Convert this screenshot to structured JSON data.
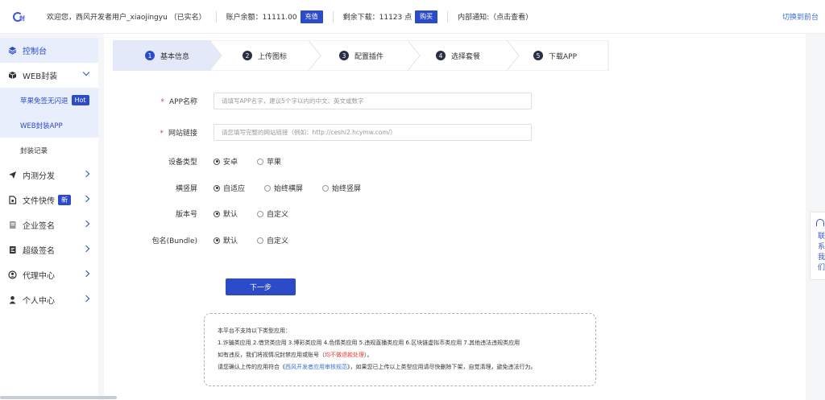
{
  "header": {
    "welcome": "欢迎您，西风开发者用户_xiaojingyu （已实名）",
    "balance_text": "账户余额：11111.00",
    "recharge_label": "充值",
    "downloads_text": "剩余下载：11123 点",
    "buy_label": "购买",
    "notice_text": "内部通知:（点击查看）",
    "switch_label": "切换到前台"
  },
  "sidebar": {
    "items": [
      {
        "label": "控制台",
        "icon": "layers-icon"
      },
      {
        "label": "WEB封装",
        "icon": "box-icon"
      },
      {
        "label": "苹果免签无闪退",
        "badge": "Hot"
      },
      {
        "label": "WEB封装APP"
      },
      {
        "label": "封装记录"
      },
      {
        "label": "内测分发",
        "icon": "send-icon"
      },
      {
        "label": "文件快传",
        "icon": "file-icon",
        "badge": "新"
      },
      {
        "label": "企业签名",
        "icon": "doc-icon"
      },
      {
        "label": "超级签名",
        "icon": "doc-sign-icon"
      },
      {
        "label": "代理中心",
        "icon": "user-circle-icon"
      },
      {
        "label": "个人中心",
        "icon": "person-icon"
      }
    ]
  },
  "steps": [
    {
      "num": "1",
      "label": "基本信息"
    },
    {
      "num": "2",
      "label": "上传图标"
    },
    {
      "num": "3",
      "label": "配置插件"
    },
    {
      "num": "4",
      "label": "选择套餐"
    },
    {
      "num": "5",
      "label": "下载APP"
    }
  ],
  "form": {
    "app_name_label": "APP名称",
    "app_name_placeholder": "请填写APP名字，建议5个字以内的中文、英文或数字",
    "url_label": "网站链接",
    "url_placeholder": "请您填写完整的网站链接（例如：http://ceshi2.hcymw.com/）",
    "device_label": "设备类型",
    "device_options": [
      "安卓",
      "苹果"
    ],
    "orient_label": "横竖屏",
    "orient_options": [
      "自适应",
      "始终横屏",
      "始终竖屏"
    ],
    "version_label": "版本号",
    "version_options": [
      "默认",
      "自定义"
    ],
    "bundle_label": "包名(Bundle)",
    "bundle_options": [
      "默认",
      "自定义"
    ],
    "next_label": "下一步"
  },
  "notice": {
    "line1": "本平台不支持以下类型应用：",
    "line2": "1.诈骗类应用 2.借贷类应用 3.博彩类应用 4.色情类应用 5.违规直播类应用 6.区块链虚拟币类应用 7.其他违法违规类应用",
    "line3_a": "如有违反，我们将视情况封禁应用或账号（",
    "line3_red": "均不做退款处理",
    "line3_b": "）。",
    "line4_a": "请您确认上传的应用符合《",
    "line4_link": "西风开发者应用审核规范",
    "line4_b": "》，如果您已上传以上类型应用请尽快删除下架，自觉清理，避免违法行为。"
  },
  "contact": {
    "label": "联系我们"
  }
}
